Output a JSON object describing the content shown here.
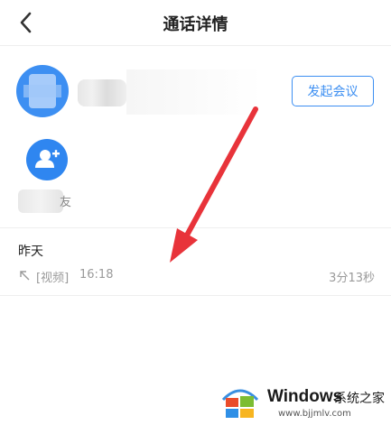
{
  "header": {
    "back_icon": "chevron-left-icon",
    "title": "通话详情"
  },
  "contact": {
    "start_meeting_label": "发起会议",
    "add_contact_icon": "add-user-icon",
    "add_contact_label_partial": "友"
  },
  "call_log": {
    "date": "昨天",
    "entries": [
      {
        "direction_icon": "outgoing-call-arrow-icon",
        "type": "[视频]",
        "time": "16:18",
        "duration": "3分13秒"
      }
    ]
  },
  "overlay": {
    "arrow_color": "#e8333a"
  },
  "watermark": {
    "brand": "Windows",
    "site_name": "系统之家",
    "url": "www.bjjmlv.com"
  },
  "colors": {
    "accent": "#3d8ff2",
    "divider": "#eeeeee",
    "secondary_text": "#9a9a9a"
  }
}
